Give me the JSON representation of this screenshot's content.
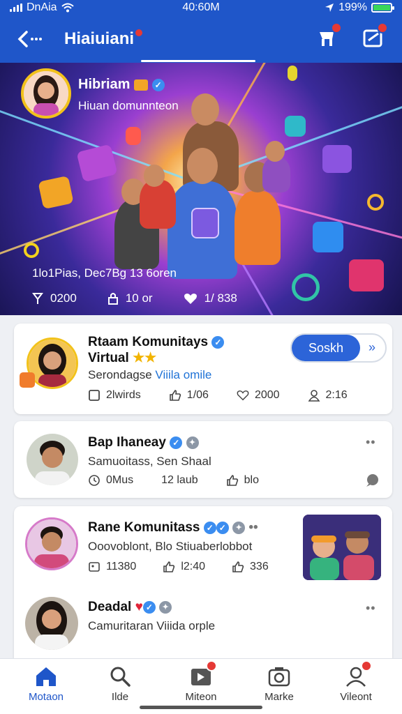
{
  "status": {
    "carrier": "DnAia",
    "time": "40:60M",
    "battery": "199%"
  },
  "header": {
    "title": "Hiaiuiani"
  },
  "hero": {
    "name": "Hibriam",
    "subtitle": "Hiuan domunnteon",
    "meta": "1lo1Pias, Dec7Bg 13 6oren",
    "stats": [
      "0200",
      "10 or",
      "1/ 838"
    ]
  },
  "cards": [
    {
      "name_line1": "Rtaam Komunitays",
      "name_line2": "Virtual",
      "sub_text": "Serondagse",
      "sub_link": "Viiila omile",
      "follow_label": "Soskh",
      "stats": [
        "2lwirds",
        "1/06",
        "2000",
        "2:16"
      ]
    },
    {
      "name": "Bap Ihaneay",
      "sub_text": "Samuoitass, Sen Shaal",
      "stats": [
        "0Mus",
        "12 laub",
        "blo"
      ]
    },
    {
      "name": "Rane Komunitass",
      "sub_text": "Ooovoblont, Blo Stiuaberlobbot",
      "stats": [
        "11380",
        "l2:40",
        "336"
      ]
    },
    {
      "name": "Deadal",
      "sub_text": "Camuritaran Viiida orple"
    }
  ],
  "nav": [
    {
      "label": "Motaon",
      "icon": "home-icon"
    },
    {
      "label": "Ilde",
      "icon": "search-icon"
    },
    {
      "label": "Miteon",
      "icon": "video-icon"
    },
    {
      "label": "Marke",
      "icon": "camera-icon"
    },
    {
      "label": "Vileont",
      "icon": "profile-icon"
    }
  ]
}
